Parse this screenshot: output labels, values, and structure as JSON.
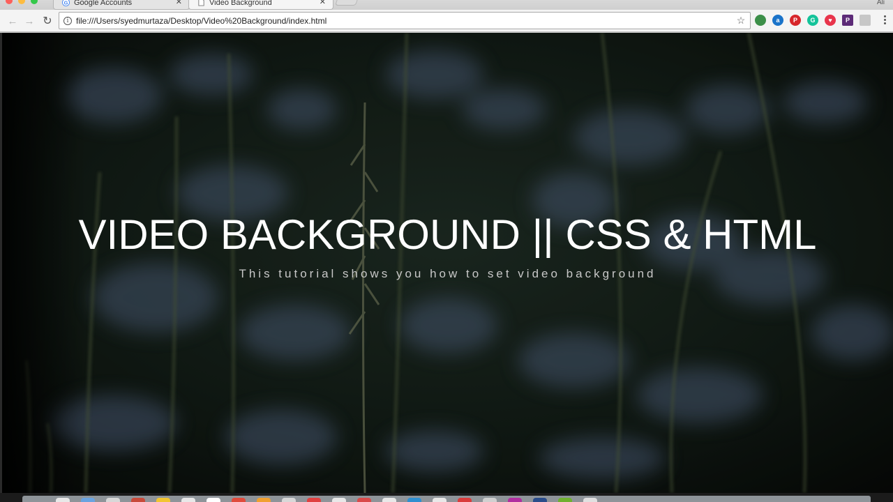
{
  "tabs": [
    {
      "title": "Google Accounts",
      "icon": "google-g-icon",
      "active": false
    },
    {
      "title": "Video Background",
      "icon": "page-icon",
      "active": true
    }
  ],
  "tabstrip_right": "Ali",
  "address_bar": {
    "url": "file:///Users/syedmurtaza/Desktop/Video%20Background/index.html"
  },
  "extensions": [
    {
      "name": "globe-extension-icon",
      "color": "#3c8f49",
      "glyph": ""
    },
    {
      "name": "atavi-extension-icon",
      "color": "#1a73c9",
      "glyph": "a"
    },
    {
      "name": "pinterest-extension-icon",
      "color": "#d7262b",
      "glyph": "P"
    },
    {
      "name": "grammarly-extension-icon",
      "color": "#15c39a",
      "glyph": "G"
    },
    {
      "name": "pocket-extension-icon",
      "color": "#e8354c",
      "glyph": "♥"
    },
    {
      "name": "p-square-extension-icon",
      "color": "#5d2b78",
      "glyph": "P"
    },
    {
      "name": "blank-extension-icon",
      "color": "#c7c7c7",
      "glyph": ""
    }
  ],
  "hero": {
    "title": "VIDEO BACKGROUND || CSS & HTML",
    "subtitle": "This tutorial shows you how to set video background"
  },
  "colors": {
    "title": "#ffffff",
    "subtitle": "#c8c8c8",
    "background": "#0e1410"
  }
}
